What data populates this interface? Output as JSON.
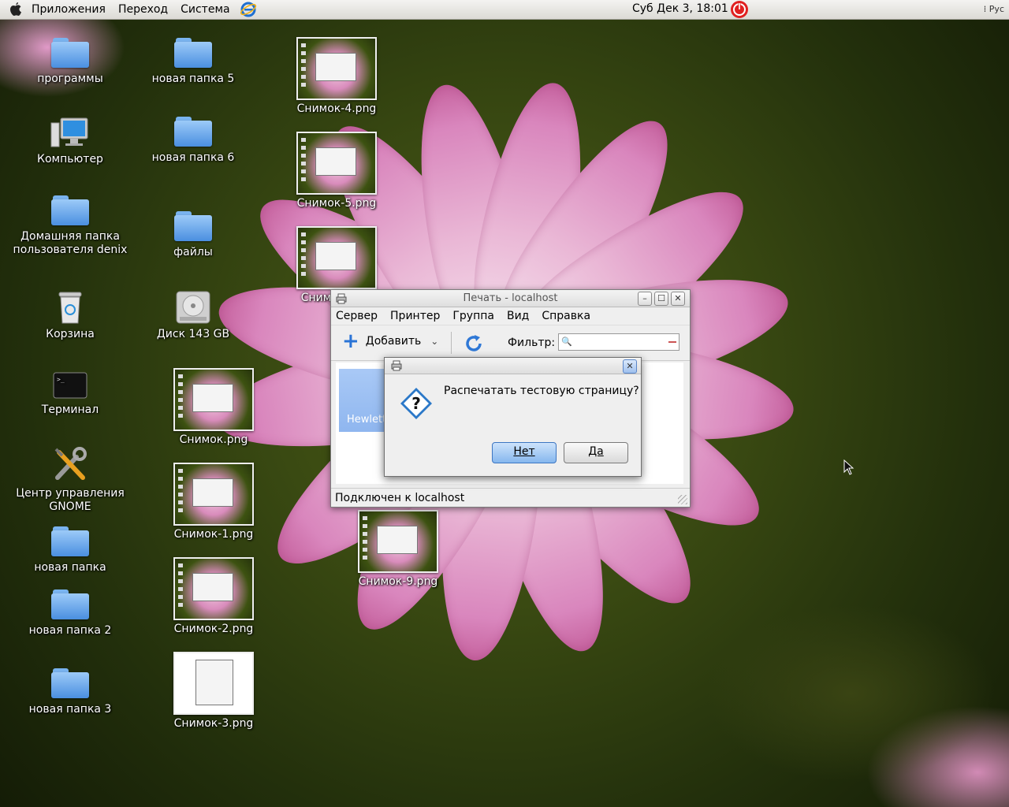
{
  "topbar": {
    "menus": [
      "Приложения",
      "Переход",
      "Система"
    ],
    "clock": "Суб Дек  3, 18:01",
    "keyboard_layout": "Рус"
  },
  "desktop": {
    "col1": [
      "программы",
      "Компьютер",
      "Домашняя папка пользователя denix",
      "Корзина",
      "Терминал",
      "Центр управления GNOME",
      "новая папка",
      "новая папка 2",
      "новая папка 3"
    ],
    "col2": [
      "новая папка 5",
      "новая папка 6",
      "файлы",
      "Диск 143 GB",
      "Снимок.png",
      "Снимок-1.png",
      "Снимок-2.png",
      "Снимок-3.png"
    ],
    "col3": [
      "Снимок-4.png",
      "Снимок-5.png",
      "Сним",
      "Снимок-9.png"
    ]
  },
  "print_window": {
    "title": "Печать - localhost",
    "menu": [
      "Сервер",
      "Принтер",
      "Группа",
      "Вид",
      "Справка"
    ],
    "add_label": "Добавить",
    "filter_label": "Фильтр:",
    "filter_value": "",
    "printer_name": "Hewlett",
    "status": "Подключен к localhost"
  },
  "dialog": {
    "message": "Распечатать тестовую страницу?",
    "no_label": "Нет",
    "yes_label": "Да"
  },
  "colors": {
    "accent": "#86b7ee",
    "selection": "#a9c9f6",
    "power": "#e02020"
  }
}
